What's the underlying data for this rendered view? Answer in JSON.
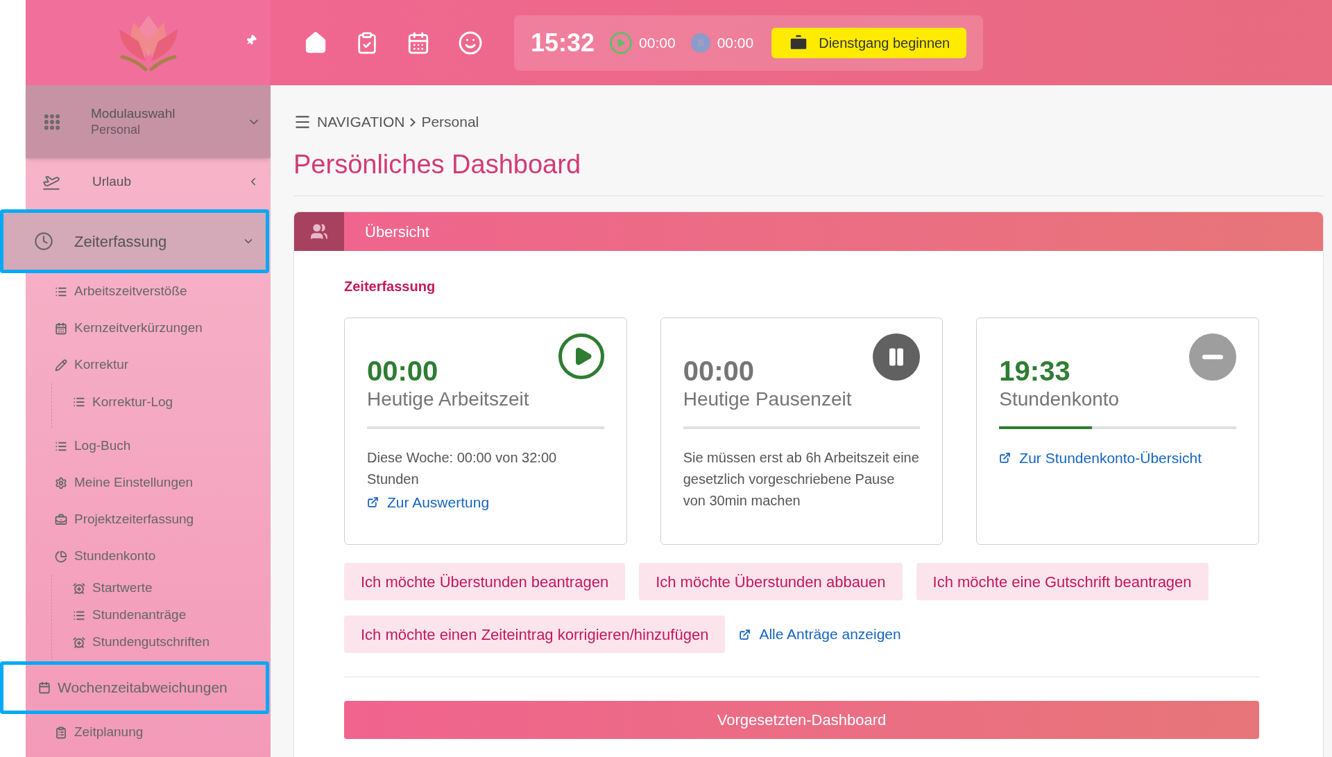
{
  "topbar": {
    "clock": "15:32",
    "work_timer": {
      "value": "00:00",
      "running": false
    },
    "pause_timer": {
      "value": "00:00",
      "running": false
    },
    "action_button": "Dienstgang beginnen"
  },
  "sidebar": {
    "module": {
      "title": "Modulauswahl",
      "subtitle": "Personal",
      "expanded": true
    },
    "sections": [
      {
        "label": "Urlaub",
        "expanded": false,
        "highlighted": false
      },
      {
        "label": "Zeiterfassung",
        "expanded": true,
        "highlighted": true
      }
    ],
    "items": [
      {
        "label": "Arbeitszeitverstöße",
        "highlighted": false
      },
      {
        "label": "Kernzeitverkürzungen",
        "highlighted": false
      },
      {
        "label": "Korrektur",
        "highlighted": false,
        "children": [
          {
            "label": "Korrektur-Log"
          }
        ]
      },
      {
        "label": "Log-Buch",
        "highlighted": false
      },
      {
        "label": "Meine Einstellungen",
        "highlighted": false
      },
      {
        "label": "Projektzeiterfassung",
        "highlighted": false
      },
      {
        "label": "Stundenkonto",
        "highlighted": false,
        "children": [
          {
            "label": "Startwerte"
          },
          {
            "label": "Stundenanträge"
          },
          {
            "label": "Stundengutschriften"
          }
        ]
      },
      {
        "label": "Wochenzeitabweichungen",
        "highlighted": true
      },
      {
        "label": "Zeitplanung",
        "highlighted": false
      }
    ]
  },
  "breadcrumb": [
    "NAVIGATION",
    "Personal"
  ],
  "page_title": "Persönliches Dashboard",
  "panel": {
    "title": "Übersicht",
    "section_title": "Zeiterfassung",
    "cards": [
      {
        "kind": "work",
        "value": "00:00",
        "label": "Heutige Arbeitszeit",
        "text": "Diese Woche: 00:00 von 32:00 Stunden",
        "link": "Zur Auswertung"
      },
      {
        "kind": "pause",
        "value": "00:00",
        "label": "Heutige Pausenzeit",
        "text": "Sie müssen erst ab 6h Arbeitszeit eine gesetzlich vorgeschriebene Pause von 30min machen"
      },
      {
        "kind": "balance",
        "value": "19:33",
        "label": "Stundenkonto",
        "level": 0.39,
        "link": "Zur Stundenkonto-Übersicht"
      }
    ],
    "actions": [
      "Ich möchte Überstunden beantragen",
      "Ich möchte Überstunden abbauen",
      "Ich möchte eine Gutschrift beantragen",
      "Ich möchte einen Zeiteintrag korrigieren/hinzufügen"
    ],
    "all_requests_link": "Alle Anträge anzeigen",
    "bottom_button": "Vorgesetzten-Dashboard"
  }
}
